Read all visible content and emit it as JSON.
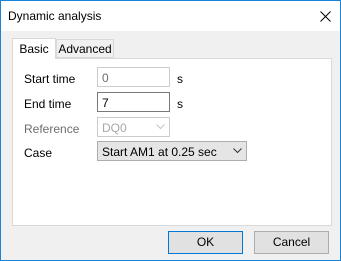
{
  "window": {
    "title": "Dynamic analysis"
  },
  "tabs": [
    {
      "label": "Basic",
      "active": true
    },
    {
      "label": "Advanced",
      "active": false
    }
  ],
  "form": {
    "start_time": {
      "label": "Start time",
      "value": "0",
      "unit": "s",
      "enabled": false
    },
    "end_time": {
      "label": "End time",
      "value": "7",
      "unit": "s",
      "enabled": true
    },
    "reference": {
      "label": "Reference",
      "value": "DQ0",
      "enabled": false
    },
    "case": {
      "label": "Case",
      "value": "Start AM1 at 0.25 sec",
      "enabled": true
    }
  },
  "buttons": {
    "ok": "OK",
    "cancel": "Cancel"
  },
  "colors": {
    "window_border": "#1883d7",
    "default_button_border": "#0078d7",
    "dialog_bg": "#f0f0f0"
  },
  "icons": {
    "close": "close-icon",
    "dropdown": "chevron-down-icon"
  }
}
